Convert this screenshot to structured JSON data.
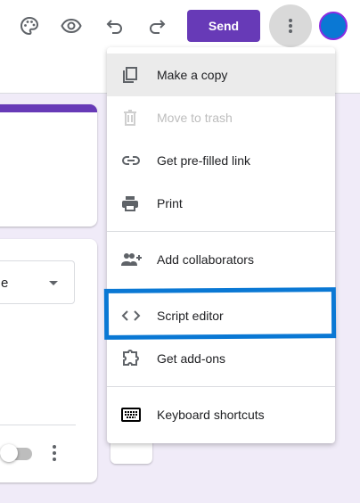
{
  "header": {
    "send_label": "Send",
    "icons": [
      "palette-icon",
      "eye-icon",
      "undo-icon",
      "redo-icon",
      "more-vert-icon"
    ]
  },
  "form": {
    "dropdown_value": "e"
  },
  "menu": {
    "items": [
      {
        "label": "Make a copy",
        "icon": "copy-icon",
        "state": "hover"
      },
      {
        "label": "Move to trash",
        "icon": "trash-icon",
        "state": "disabled"
      },
      {
        "label": "Get pre-filled link",
        "icon": "link-icon"
      },
      {
        "label": "Print",
        "icon": "print-icon"
      },
      {
        "label": "Add collaborators",
        "icon": "add-people-icon"
      },
      {
        "label": "Script editor",
        "icon": "code-icon",
        "highlighted": true
      },
      {
        "label": "Get add-ons",
        "icon": "puzzle-icon"
      },
      {
        "label": "Keyboard shortcuts",
        "icon": "keyboard-icon"
      }
    ]
  },
  "colors": {
    "accent": "#673ab7",
    "highlight": "#0a78d4",
    "background": "#f0ebf8"
  }
}
